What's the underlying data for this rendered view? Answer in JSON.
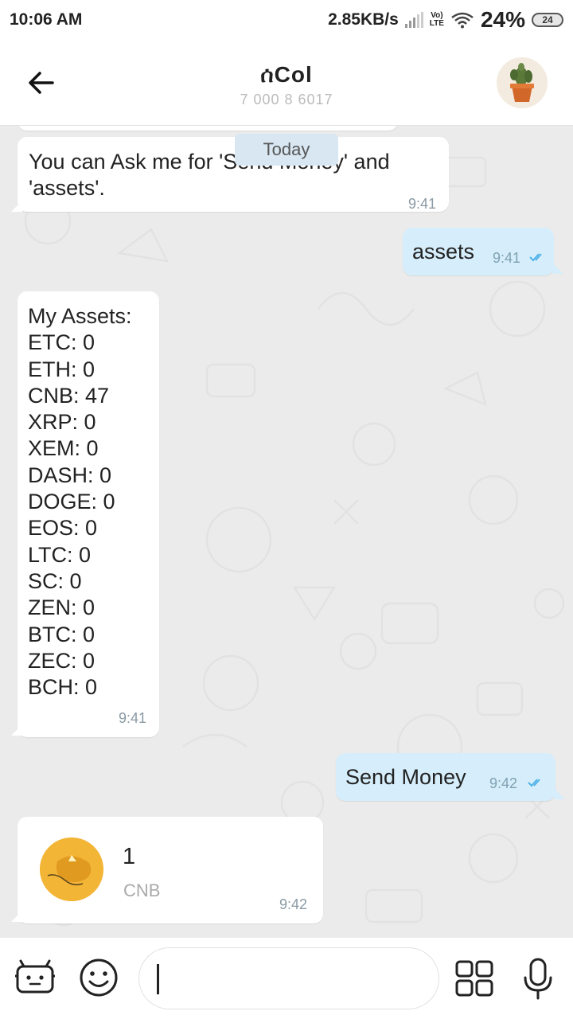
{
  "status_bar": {
    "time": "10:06 AM",
    "net_speed": "2.85KB/s",
    "lte_top": "Vo)",
    "lte_bottom": "LTE",
    "battery_percent": "24%",
    "battery_level": "24"
  },
  "header": {
    "title": "ሰCol",
    "subtitle": "7 000 8 6017",
    "icons": [
      "back-arrow-icon",
      "cactus-avatar"
    ]
  },
  "chat": {
    "date_divider": "Today",
    "messages": [
      {
        "direction": "incoming",
        "text": "You can Ask me for 'Send Money' and\n'assets'.",
        "time": "9:41"
      },
      {
        "direction": "outgoing",
        "text": "assets",
        "time": "9:41",
        "status": "read"
      },
      {
        "direction": "incoming",
        "text": "My Assets:\nETC: 0\nETH: 0\nCNB: 47\nXRP: 0\nXEM: 0\nDASH: 0\nDOGE: 0\nEOS: 0\nLTC: 0\nSC: 0\nZEN: 0\nBTC: 0\nZEC: 0\nBCH: 0",
        "time": "9:41"
      },
      {
        "direction": "outgoing",
        "text": "Send Money",
        "time": "9:42",
        "status": "read"
      },
      {
        "direction": "incoming",
        "type": "amount-card",
        "amount": "1",
        "unit": "CNB",
        "time": "9:42"
      }
    ]
  },
  "input_bar": {
    "icons": [
      "bot-icon",
      "emoji-icon",
      "apps-grid-icon",
      "microphone-icon"
    ],
    "message_value": ""
  },
  "colors": {
    "chat_bg": "#ebebeb",
    "outgoing_bubble": "#d6eefb",
    "incoming_bubble": "#ffffff",
    "read_tick": "#4fb3e8",
    "coin": "#f3b536"
  }
}
